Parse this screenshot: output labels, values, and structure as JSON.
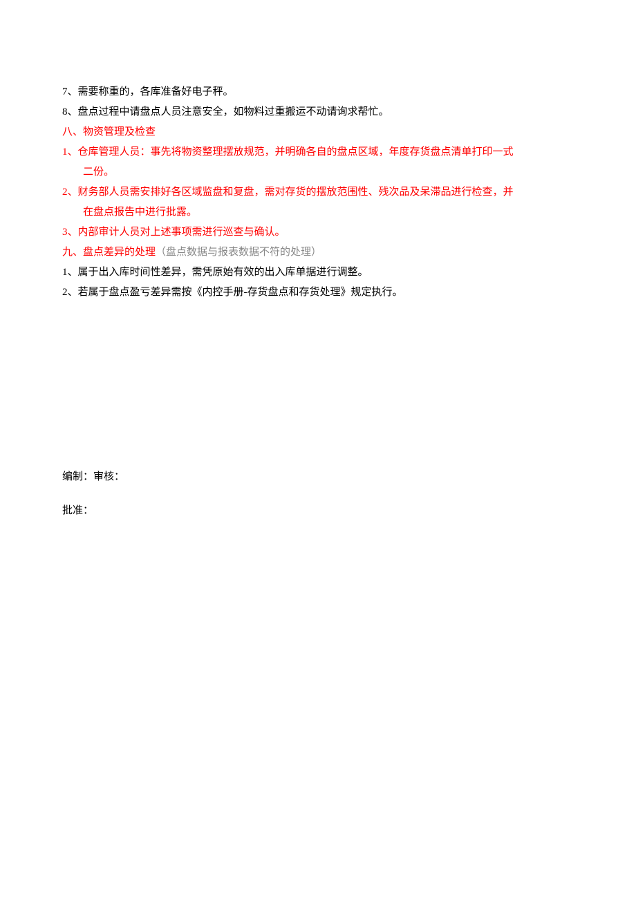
{
  "items": {
    "item7": "7、需要称重的，各库准备好电子秤。",
    "item8": "8、盘点过程中请盘点人员注意安全，如物料过重搬运不动请询求帮忙。"
  },
  "section8": {
    "heading": "八、物资管理及检查",
    "item1_line1": "1、仓库管理人员：事先将物资整理摆放规范，并明确各自的盘点区域，年度存货盘点清单打印一式",
    "item1_line2": "二份。",
    "item2_line1": "2、财务部人员需安排好各区域监盘和复盘，需对存货的摆放范围性、残次品及呆滞品进行检查，并",
    "item2_line2": "在盘点报告中进行批露。",
    "item3": "3、内部审计人员对上述事项需进行巡查与确认。"
  },
  "section9": {
    "heading_main": "九、盘点差异的处理",
    "heading_paren": "（盘点数据与报表数据不符的处理）",
    "item1": "1、属于出入库时间性差异，需凭原始有效的出入库单据进行调整。",
    "item2": "2、若属于盘点盈亏差异需按《内控手册-存货盘点和存货处理》规定执行。"
  },
  "signatures": {
    "line1": "编制：审核：",
    "line2": "批准："
  }
}
